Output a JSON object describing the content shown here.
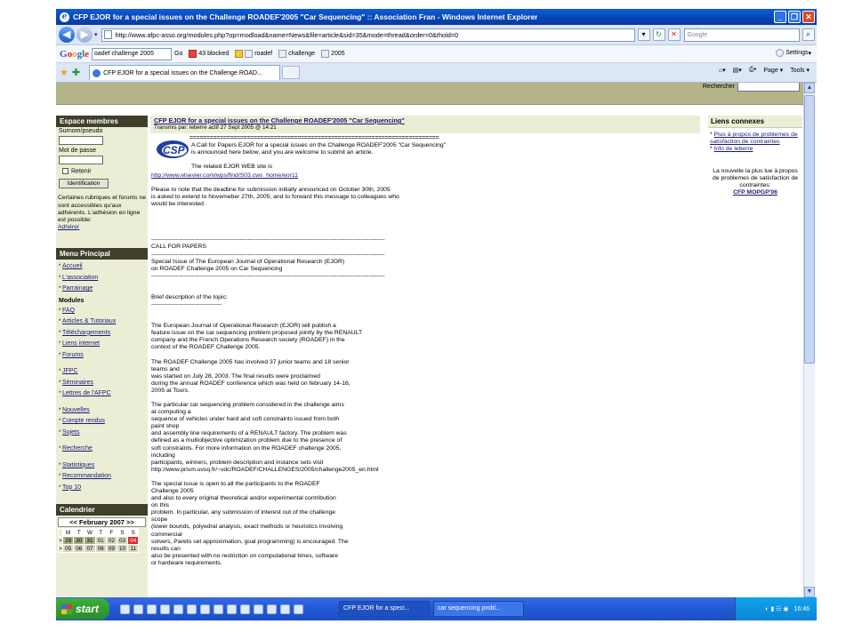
{
  "window": {
    "title": "CFP EJOR for a special issues on the Challenge ROADEF'2005 \"Car Sequencing\" :: Association Fran - Windows Internet Explorer"
  },
  "address": {
    "url": "http://www.afpc-asso.org/modules.php?op=modload&name=News&file=article&sid=35&mode=thread&order=0&thold=0",
    "search_placeholder": "Google"
  },
  "gtoolbar": {
    "query": "oadef challenge 2005",
    "go": "Go",
    "blocked": "43 blocked",
    "items": [
      "roadef",
      "challenge",
      "2005"
    ],
    "settings": "Settings"
  },
  "tabs": {
    "active": "CFP EJOR for a special issues on the Challenge ROAD...",
    "page": "Page",
    "tools": "Tools"
  },
  "page": {
    "search_label": "Rechercher",
    "left": {
      "members_title": "Espace membres",
      "login_label": "Surnom/pseudo",
      "password_label": "Mot de passe",
      "remember": "Retenir",
      "submit": "Identification",
      "notice": "Certaines rubriques et forums ne sont accessibles qu'aux adhérents. L'adhésion en ligne est possible:",
      "join_link": "Adhérer",
      "menu_title": "Menu Principal",
      "menu": [
        "Accueil",
        "L'association",
        "Parrainage"
      ],
      "modules_title": "Modules",
      "modules": [
        [
          "FAQ",
          "Articles & Tutoriaux",
          "Téléchargements",
          "Liens internet",
          "Forums"
        ],
        [
          "JFPC",
          "Séminaires",
          "Lettres de l'AFPC"
        ],
        [
          "Nouvelles",
          "Compte rendus",
          "Sujets"
        ],
        [
          "Recherche"
        ],
        [
          "Statistiques",
          "Recommandation",
          "Top 10"
        ]
      ],
      "calendar_title": "Calendrier",
      "calendar_month": "<< February 2007 >>",
      "calendar_days": [
        "M",
        "T",
        "W",
        "T",
        "F",
        "S",
        "S"
      ],
      "calendar_rows": [
        [
          ">",
          "29",
          "30",
          "31",
          "01",
          "02",
          "03",
          "04"
        ],
        [
          ">",
          "05",
          "06",
          "07",
          "08",
          "09",
          "10",
          "11"
        ]
      ]
    },
    "article": {
      "title": "CFP EJOR for a special issues on the Challenge ROADEF'2005 \"Car Sequencing\"",
      "byline": "Transmis par: leberre actif 27 Sept 2005 @ 14:21",
      "logo_text": "CSP",
      "separator": "==========================================================================",
      "intro": [
        "A Call for Papers EJOR for a special issues on the Challenge ROADEF'2005 \"Car Sequencing\"",
        "is announced here below, and you are welcome to submit an article.",
        "",
        "The related EJOR WEB site is"
      ],
      "paragraphs": [
        "http://www.elsevier.com/wps/find/S03.cws_home/eor11",
        "",
        "Please to note that the deadline for submission initially announced on October 30th, 2005\nis asked to extend to Novemeber 27th, 2005; and to forward this message to colleagues who\nwould be interested.",
        "",
        "",
        "",
        "",
        "--------------------------------------------------------------------------------------------------------------------\nCALL FOR PAPERS\n--------------------------------------------------------------------------------------------------------------------\nSpecial Issue of The European Journal of Operational Research (EJOR)\non ROADEF Challenge 2005 on Car Sequencing\n--------------------------------------------------------------------------------------------------------------------",
        "",
        "",
        "Brief description of the topic:\n-----------------------------------",
        "",
        "",
        "The European Journal of Operational Research (EJOR) will publish a\nfeature issue on the car sequencing problem proposed jointly by the RENAULT\ncompany and the French Operations Research society (ROADEF) in the\ncontext of the ROADEF Challenge 2005.",
        "",
        "The ROADEF Challenge 2005 has involved 37 junior teams and 18 senior\nteams and\nwas started on July 28, 2003. The final results were proclaimed\nduring the annual ROADEF conference which was held on february 14-16,\n2005 at Tours.",
        "",
        "The particular car sequencing problem considered in the challenge aims\nat computing a\nsequence of vehicles under hard and soft constraints issued from both\npaint shop\nand assembly line requirements of a RENAULT factory. The problem was\ndefined as a multiobjective optimization problem due to the presence of\nsoft constraints. For more information on the ROADEF challenge 2005,\nincluding\nparticipants, winners, problem description and instance sets visit\nhttp://www.prism.uvsq.fr/~vdc/ROADEF/CHALLENGES/2005/challenge2005_en.html",
        "",
        "The special issue is open to all the participants to the ROADEF\nChallenge 2005\nand also to every original theoretical and/or experimental contribution\non this\nproblem. In particular, any submission of interest out of the challenge\nscope\n(lower bounds, polyedral analysis, exact methods or heuristics involving\ncommercial\nsolvers, Pareto set approximation, goal programming) is encouraged. The\nresults can\nalso be presented with no restriction on computational times, software\nor hardware requirements."
      ]
    },
    "right": {
      "title": "Liens connexes",
      "links": [
        "Plus à propos de problemes de satisfaction de contraintes",
        "Info de leberre"
      ],
      "popular_text": "La nouvelle la plus lue à propos de problemes de satisfaction de contraintes:",
      "popular_link": "CFP MOPGP'06"
    }
  },
  "taskbar": {
    "start": "start",
    "tasks": [
      "CFP EJOR for a speci...",
      "car sequencing probl..."
    ],
    "clock": "16:46"
  }
}
